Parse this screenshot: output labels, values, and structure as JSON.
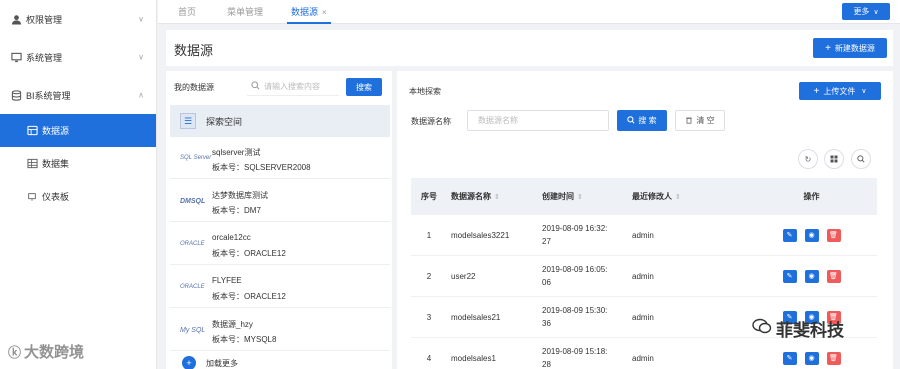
{
  "sidebar": {
    "groups": [
      {
        "label": "权限管理",
        "icon": "user-icon",
        "chevron": "∨"
      },
      {
        "label": "系统管理",
        "icon": "monitor-icon",
        "chevron": "∨"
      },
      {
        "label": "BI系统管理",
        "icon": "database-icon",
        "chevron": "∧"
      }
    ],
    "items": [
      {
        "label": "数据源",
        "icon": "datasource-icon",
        "active": true
      },
      {
        "label": "数据集",
        "icon": "dataset-icon",
        "active": false
      },
      {
        "label": "仪表板",
        "icon": "dashboard-icon",
        "active": false
      }
    ]
  },
  "tabs": [
    {
      "label": "首页",
      "active": false
    },
    {
      "label": "菜单管理",
      "active": false
    },
    {
      "label": "数据源",
      "active": true,
      "close": "×"
    }
  ],
  "more_button": "更多",
  "page": {
    "title": "数据源",
    "new_button": "新建数据源"
  },
  "left_panel": {
    "heading": "我的数据源",
    "search_placeholder": "请输入搜索内容",
    "search_button": "搜索",
    "space_label": "探索空间",
    "datasources": [
      {
        "logo": "SQL Server",
        "name": "sqlserver测试",
        "version": "板本号：SQLSERVER2008"
      },
      {
        "logo": "DMSQL",
        "name": "达梦数据库测试",
        "version": "板本号：DM7"
      },
      {
        "logo": "ORACLE",
        "name": "orcale12cc",
        "version": "板本号：ORACLE12"
      },
      {
        "logo": "ORACLE",
        "name": "FLYFEE",
        "version": "板本号：ORACLE12"
      },
      {
        "logo": "My SQL",
        "name": "数据源_hzy",
        "version": "板本号：MYSQL8"
      }
    ],
    "load_more": "加载更多"
  },
  "right_panel": {
    "title": "本地探索",
    "upload_button": "上传文件",
    "name_label": "数据源名称",
    "name_placeholder": "数据源名称",
    "search_button": "搜 索",
    "clear_button": "清 空",
    "table": {
      "headers": [
        "序号",
        "数据源名称",
        "创建时间",
        "最近修改人",
        "操作"
      ],
      "rows": [
        {
          "idx": "1",
          "name": "modelsales3221",
          "time1": "2019-08-09 16:32:",
          "time2": "27",
          "user": "admin"
        },
        {
          "idx": "2",
          "name": "user22",
          "time1": "2019-08-09 16:05:",
          "time2": "06",
          "user": "admin"
        },
        {
          "idx": "3",
          "name": "modelsales21",
          "time1": "2019-08-09 15:30:",
          "time2": "36",
          "user": "admin"
        },
        {
          "idx": "4",
          "name": "modelsales1",
          "time1": "2019-08-09 15:18:",
          "time2": "28",
          "user": "admin"
        }
      ]
    }
  },
  "watermarks": {
    "left": "大数跨境",
    "right": "菲斐科技"
  },
  "colors": {
    "primary": "#1f6fdc",
    "danger": "#ef5b5b"
  }
}
